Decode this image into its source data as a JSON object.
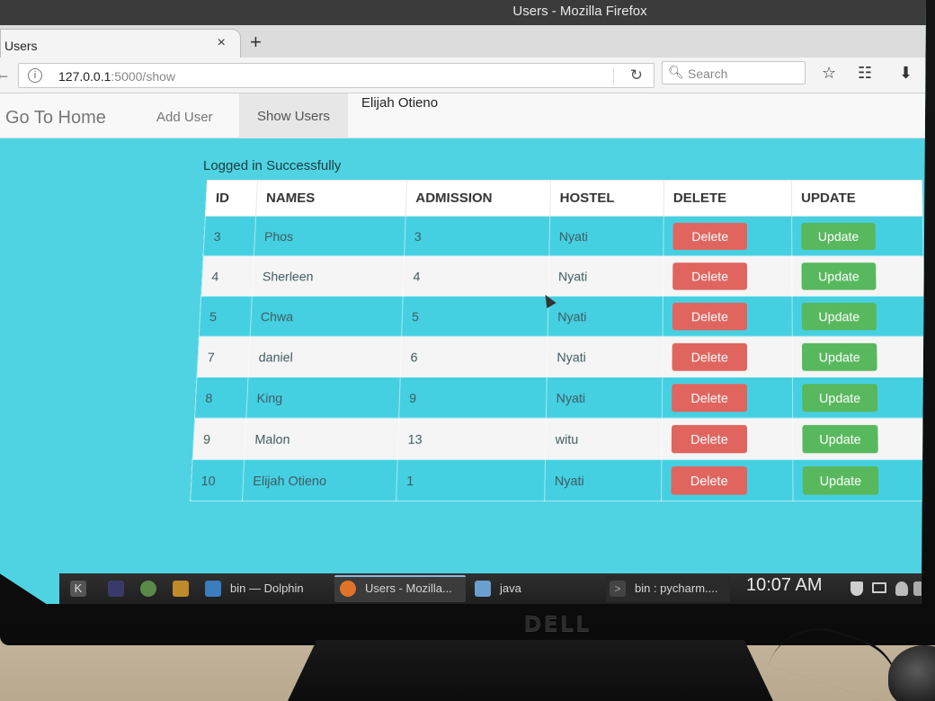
{
  "window": {
    "title": "Users - Mozilla Firefox"
  },
  "tab": {
    "title": "Users",
    "close": "×",
    "new_tab": "+"
  },
  "address": {
    "host": "127.0.0.1",
    "rest": ":5000/show"
  },
  "search": {
    "placeholder": "Search"
  },
  "app_nav": {
    "brand": "Go To Home",
    "links": [
      "Add User",
      "Show Users"
    ],
    "active": "Show Users",
    "user": "Elijah Otieno"
  },
  "status_message": "Logged in Successfully",
  "table": {
    "headers": [
      "ID",
      "NAMES",
      "ADMISSION",
      "HOSTEL",
      "DELETE",
      "UPDATE"
    ],
    "delete_label": "Delete",
    "update_label": "Update",
    "rows": [
      {
        "id": "3",
        "name": "Phos",
        "admission": "3",
        "hostel": "Nyati"
      },
      {
        "id": "4",
        "name": "Sherleen",
        "admission": "4",
        "hostel": "Nyati"
      },
      {
        "id": "5",
        "name": "Chwa",
        "admission": "5",
        "hostel": "Nyati"
      },
      {
        "id": "7",
        "name": "daniel",
        "admission": "6",
        "hostel": "Nyati"
      },
      {
        "id": "8",
        "name": "King",
        "admission": "9",
        "hostel": "Nyati"
      },
      {
        "id": "9",
        "name": "Malon",
        "admission": "13",
        "hostel": "witu"
      },
      {
        "id": "10",
        "name": "Elijah Otieno",
        "admission": "1",
        "hostel": "Nyati"
      }
    ]
  },
  "taskbar": {
    "items": [
      "bin — Dolphin",
      "Users - Mozilla...",
      "java",
      "bin : pycharm...."
    ],
    "clock": "10:07 AM"
  },
  "monitor_brand": "DELL",
  "colors": {
    "page_bg": "#4fd3e2",
    "delete": "#e0655f",
    "update": "#58b85e"
  }
}
